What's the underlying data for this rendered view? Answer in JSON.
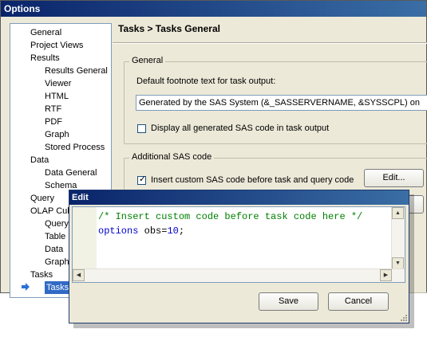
{
  "window": {
    "title": "Options"
  },
  "nav": {
    "items": [
      {
        "label": "General",
        "level": 0
      },
      {
        "label": "Project Views",
        "level": 0
      },
      {
        "label": "Results",
        "level": 0
      },
      {
        "label": "Results General",
        "level": 1
      },
      {
        "label": "Viewer",
        "level": 1
      },
      {
        "label": "HTML",
        "level": 1
      },
      {
        "label": "RTF",
        "level": 1
      },
      {
        "label": "PDF",
        "level": 1
      },
      {
        "label": "Graph",
        "level": 1
      },
      {
        "label": "Stored Process",
        "level": 1
      },
      {
        "label": "Data",
        "level": 0
      },
      {
        "label": "Data General",
        "level": 1
      },
      {
        "label": "Schema",
        "level": 1
      },
      {
        "label": "Query",
        "level": 0
      },
      {
        "label": "OLAP Cub",
        "level": 0
      },
      {
        "label": "Query",
        "level": 1
      },
      {
        "label": "Table",
        "level": 1
      },
      {
        "label": "Data",
        "level": 1
      },
      {
        "label": "Graph",
        "level": 1
      },
      {
        "label": "Tasks",
        "level": 0
      },
      {
        "label": "Tasks",
        "level": 1,
        "selected": true
      }
    ]
  },
  "header": {
    "breadcrumb": "Tasks > Tasks General"
  },
  "general_group": {
    "label": "General",
    "footnote_label": "Default footnote text for task output:",
    "footnote_value": "Generated by the SAS System (&_SASSERVERNAME, &SYSSCPL) on %SY",
    "display_code_label": "Display all generated SAS code in task output",
    "display_code_checked": false
  },
  "additional_group": {
    "label": "Additional SAS code",
    "insert_custom_label": "Insert custom SAS code before task and query code",
    "insert_custom_checked": true,
    "edit_button": "Edit..."
  },
  "edit_dialog": {
    "title": "Edit",
    "code_line_1": "/* Insert custom code before task code here */",
    "code_line_2_keyword": "options",
    "code_line_2_text": " obs=",
    "code_line_2_number": "10",
    "code_line_2_end": ";",
    "save_button": "Save",
    "cancel_button": "Cancel"
  },
  "colors": {
    "titlebar": "#0a246a",
    "selection": "#316ac5",
    "comment": "#008000",
    "keyword": "#0000cc",
    "window_bg": "#ece9d8"
  }
}
